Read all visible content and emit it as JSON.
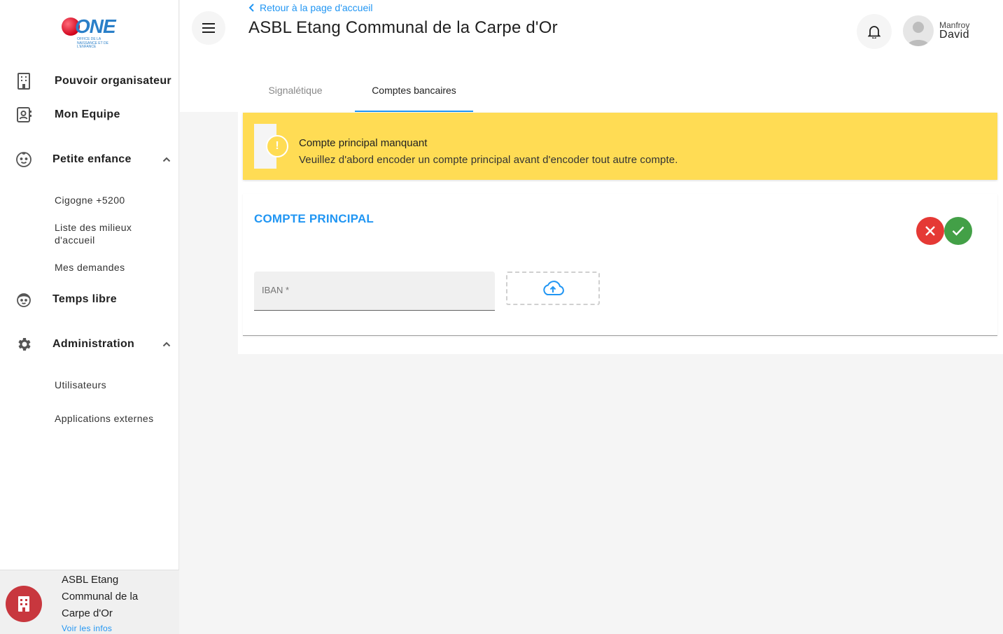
{
  "sidebar": {
    "logo": {
      "text": "ONE",
      "subtitle": "OFFICE DE LA NAISSANCE ET DE L'ENFANCE"
    },
    "items": [
      {
        "label": "Pouvoir organisateur",
        "icon": "building-icon"
      },
      {
        "label": "Mon Equipe",
        "icon": "contact-card-icon"
      },
      {
        "label": "Petite enfance",
        "icon": "baby-face-icon",
        "expanded": true,
        "children": [
          "Cigogne +5200",
          "Liste des milieux d'accueil",
          "Mes demandes"
        ]
      },
      {
        "label": "Temps libre",
        "icon": "child-face-icon"
      },
      {
        "label": "Administration",
        "icon": "gear-icon",
        "expanded": true,
        "children": [
          "Utilisateurs",
          "Applications externes"
        ]
      }
    ],
    "org": {
      "name": "ASBL Etang Communal de la Carpe d'Or",
      "link": "Voir les infos"
    }
  },
  "header": {
    "back_link": "Retour à la page d'accueil",
    "title": "ASBL Etang Communal de la Carpe d'Or",
    "user": {
      "first_name": "Manfroy",
      "last_name": "David"
    },
    "tabs": [
      {
        "label": "Signalétique",
        "active": false
      },
      {
        "label": "Comptes bancaires",
        "active": true
      }
    ]
  },
  "alert": {
    "title": "Compte principal manquant",
    "text": "Veuillez d'abord encoder un compte principal avant d'encoder tout autre compte.",
    "color": "#ffdc54"
  },
  "card": {
    "title": "COMPTE PRINCIPAL",
    "iban_label": "IBAN *",
    "iban_value": "",
    "accent": "#2196f3",
    "cancel_color": "#e53935",
    "confirm_color": "#43a047"
  }
}
